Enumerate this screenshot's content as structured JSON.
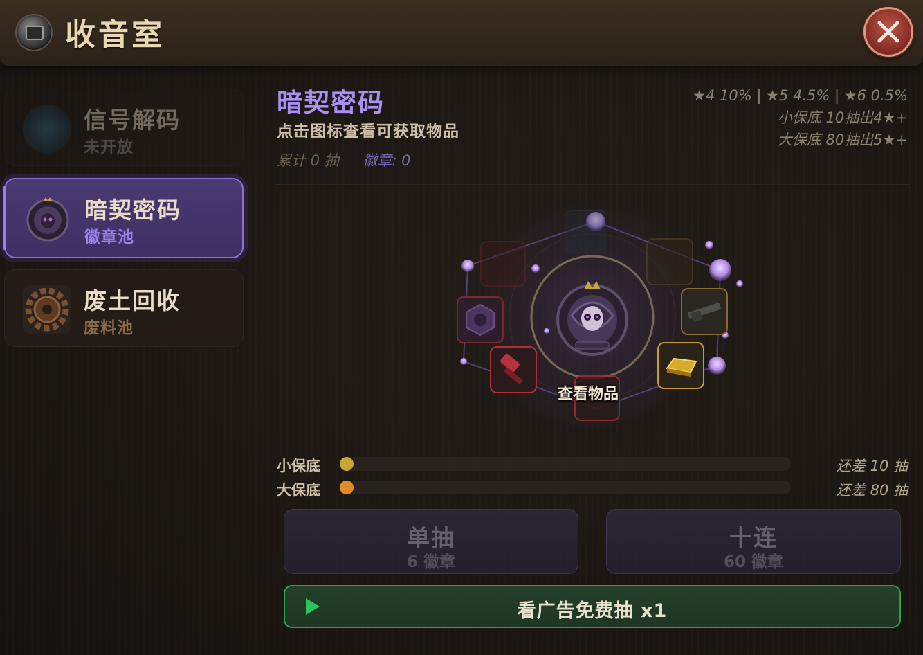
{
  "header": {
    "title": "收音室",
    "icon": "radio-room-icon"
  },
  "sidebar": {
    "items": [
      {
        "title": "信号解码",
        "subtitle": "未开放",
        "state": "locked",
        "subtitle_color": "#8c8c8c"
      },
      {
        "title": "暗契密码",
        "subtitle": "徽章池",
        "state": "active",
        "subtitle_color": "#9b82e8"
      },
      {
        "title": "废土回收",
        "subtitle": "废料池",
        "state": "normal",
        "subtitle_color": "#8a6a48"
      }
    ]
  },
  "pool": {
    "title": "暗契密码",
    "hint": "点击图标查看可获取物品",
    "total_draws": "累计 0 抽",
    "badges": "徽章: 0",
    "rates": "★4 10% | ★5 4.5% | ★6 0.5%",
    "small_pity_rule": "小保底 10抽出4★+",
    "big_pity_rule": "大保底 80抽出5★+",
    "view_items_label": "查看物品"
  },
  "pity": {
    "small": {
      "label": "小保底",
      "remaining": "还差 10 抽",
      "progress": 0,
      "color": "#c9a43c"
    },
    "big": {
      "label": "大保底",
      "remaining": "还差 80 抽",
      "progress": 0,
      "color": "#e08a28"
    }
  },
  "buttons": {
    "single": {
      "label": "单抽",
      "cost": "6 徽章"
    },
    "ten": {
      "label": "十连",
      "cost": "60 徽章"
    },
    "ad": {
      "label": "看广告免费抽 x1",
      "icon": "play-icon"
    }
  },
  "colors": {
    "accent_purple": "#a98ff2",
    "ad_green": "#2fa14a"
  }
}
